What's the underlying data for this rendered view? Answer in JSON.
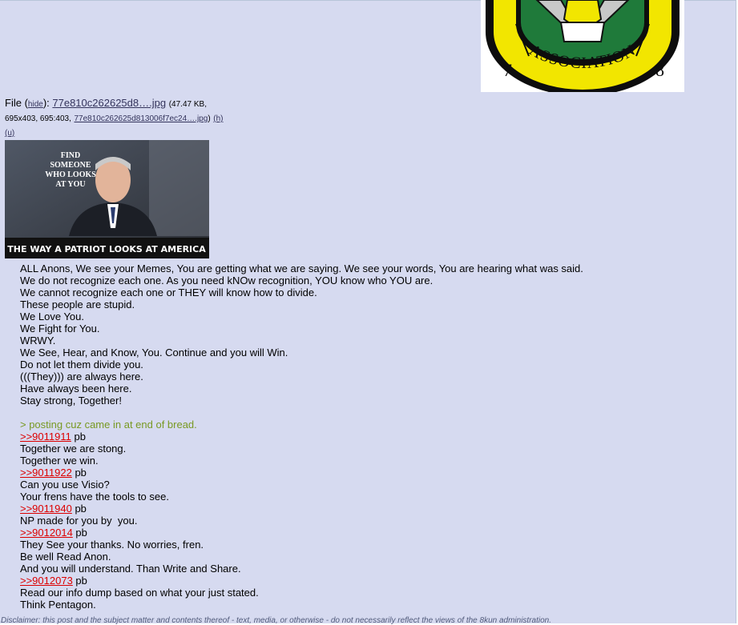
{
  "badge": {
    "text_left": "7",
    "text_center": "ASSOCIATION",
    "text_right": "8"
  },
  "file": {
    "label": "File",
    "hide_label": "hide",
    "filename": "77e810c262625d8….jpg",
    "size": "47.47 KB,",
    "dims": "695x403, 695:403,",
    "full_name": "77e810c262625d813006f7ec24….jpg",
    "h_label": "(h)",
    "u_label": "(u)"
  },
  "thumbnail": {
    "top_text": [
      "FIND",
      "SOMEONE",
      "WHO LOOKS",
      "AT YOU"
    ],
    "caption": "THE WAY A PATRIOT LOOKS AT AMERICA"
  },
  "post": {
    "lines": [
      {
        "type": "text",
        "text": "ALL Anons, We see your Memes, You are getting what we are saying. We see your words, You are hearing what was said."
      },
      {
        "type": "text",
        "text": "We do not recognize each one. As you need kNOw recognition, YOU know who YOU are."
      },
      {
        "type": "text",
        "text": "We cannot recognize each one or THEY will know how to divide."
      },
      {
        "type": "text",
        "text": "These people are stupid."
      },
      {
        "type": "text",
        "text": "We Love You."
      },
      {
        "type": "text",
        "text": "We Fight for You."
      },
      {
        "type": "text",
        "text": "WRWY."
      },
      {
        "type": "text",
        "text": "We See, Hear, and Know, You. Continue and you will Win."
      },
      {
        "type": "text",
        "text": "Do not let them divide you."
      },
      {
        "type": "text",
        "text": "(((They))) are always here."
      },
      {
        "type": "text",
        "text": "Have always been here."
      },
      {
        "type": "text",
        "text": "Stay strong, Together!"
      },
      {
        "type": "blank",
        "text": ""
      },
      {
        "type": "green",
        "text": "> posting cuz came in at end of bread."
      },
      {
        "type": "ref",
        "ref": ">>9011911",
        "text": " pb"
      },
      {
        "type": "text",
        "text": "Together we are stong."
      },
      {
        "type": "text",
        "text": "Together we win."
      },
      {
        "type": "ref",
        "ref": ">>9011922",
        "text": " pb"
      },
      {
        "type": "text",
        "text": "Can you use Visio?"
      },
      {
        "type": "text",
        "text": "Your frens have the tools to see."
      },
      {
        "type": "ref",
        "ref": ">>9011940",
        "text": " pb"
      },
      {
        "type": "text",
        "text": "NP made for you by  you."
      },
      {
        "type": "ref",
        "ref": ">>9012014",
        "text": " pb"
      },
      {
        "type": "text",
        "text": "They See your thanks. No worries, fren."
      },
      {
        "type": "text",
        "text": "Be well Read Anon."
      },
      {
        "type": "text",
        "text": "And you will understand. Than Write and Share."
      },
      {
        "type": "ref",
        "ref": ">>9012073",
        "text": " pb"
      },
      {
        "type": "text",
        "text": "Read our info dump based on what your just stated."
      },
      {
        "type": "text",
        "text": "Think Pentagon."
      }
    ]
  },
  "disclaimer": "Disclaimer: this post and the subject matter and contents thereof - text, media, or otherwise - do not necessarily reflect the views of the 8kun administration."
}
